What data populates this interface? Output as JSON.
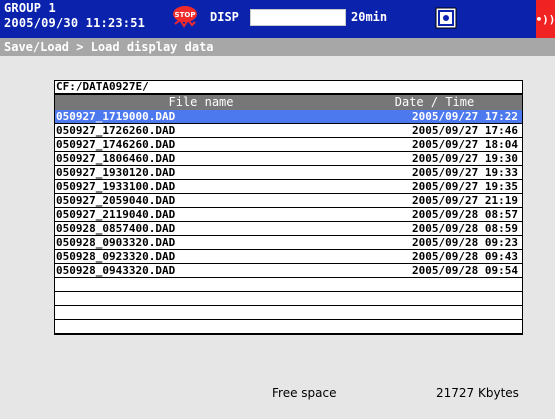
{
  "header": {
    "group_line": "GROUP 1",
    "datetime": "2005/09/30 11:23:51",
    "disp_label": "DISP",
    "rate_label": "20min",
    "alarm_label": "•))"
  },
  "breadcrumb": {
    "text": "Save/Load > Load display data"
  },
  "path": {
    "value": "CF:/DATA0927E/"
  },
  "table": {
    "col_name": "File name",
    "col_date": "Date / Time",
    "rows": [
      {
        "name": "050927_1719000.DAD",
        "date": "2005/09/27 17:22",
        "selected": true
      },
      {
        "name": "050927_1726260.DAD",
        "date": "2005/09/27 17:46"
      },
      {
        "name": "050927_1746260.DAD",
        "date": "2005/09/27 18:04"
      },
      {
        "name": "050927_1806460.DAD",
        "date": "2005/09/27 19:30"
      },
      {
        "name": "050927_1930120.DAD",
        "date": "2005/09/27 19:33"
      },
      {
        "name": "050927_1933100.DAD",
        "date": "2005/09/27 19:35"
      },
      {
        "name": "050927_2059040.DAD",
        "date": "2005/09/27 21:19"
      },
      {
        "name": "050927_2119040.DAD",
        "date": "2005/09/28 08:57"
      },
      {
        "name": "050928_0857400.DAD",
        "date": "2005/09/28 08:59"
      },
      {
        "name": "050928_0903320.DAD",
        "date": "2005/09/28 09:23"
      },
      {
        "name": "050928_0923320.DAD",
        "date": "2005/09/28 09:43"
      },
      {
        "name": "050928_0943320.DAD",
        "date": "2005/09/28 09:54"
      },
      {
        "name": "",
        "date": ""
      },
      {
        "name": "",
        "date": ""
      },
      {
        "name": "",
        "date": ""
      },
      {
        "name": "",
        "date": ""
      }
    ]
  },
  "footer": {
    "free_label": "Free space",
    "free_value": "21727 Kbytes"
  },
  "colors": {
    "topbar": "#0b22ad",
    "breadcrumb": "#a7a7a7",
    "selected_row": "#4d79ef",
    "alarm": "#f02222"
  }
}
